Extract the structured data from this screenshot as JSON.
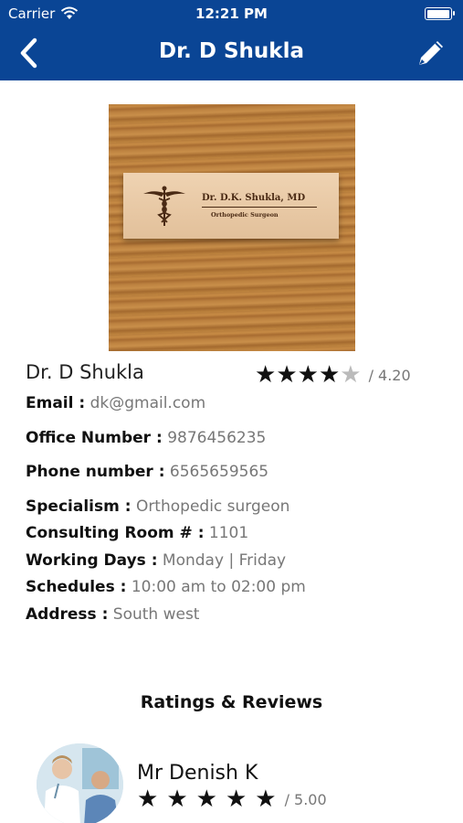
{
  "status_bar": {
    "carrier": "Carrier",
    "time": "12:21 PM"
  },
  "header": {
    "title": "Dr. D Shukla",
    "back_icon": "chevron-left-icon",
    "edit_icon": "pencil-icon"
  },
  "photo": {
    "plaque_name": "Dr. D.K. Shukla, MD",
    "plaque_subtitle": "Orthopedic Surgeon"
  },
  "doctor": {
    "name": "Dr. D Shukla",
    "rating": 4.2,
    "rating_text": "/ 4.20",
    "max_stars": 5,
    "filled_stars": 4
  },
  "details": {
    "email_label": "Email :",
    "email_value": "dk@gmail.com",
    "office_label": "Office Number :",
    "office_value": "9876456235",
    "phone_label": "Phone number :",
    "phone_value": "6565659565",
    "specialism_label": "Specialism :",
    "specialism_value": "Orthopedic surgeon",
    "room_label": "Consulting Room # :",
    "room_value": "1101",
    "days_label": "Working Days :",
    "days_value": "Monday | Friday",
    "schedule_label": "Schedules :",
    "schedule_value": "10:00 am to 02:00 pm",
    "address_label": "Address :",
    "address_value": "South west"
  },
  "reviews": {
    "title": "Ratings & Reviews",
    "items": [
      {
        "name": "Mr Denish K",
        "rating": 5.0,
        "rating_text": "/ 5.00"
      }
    ]
  },
  "colors": {
    "header_bg": "#0a4595",
    "label": "#111111",
    "value": "#777777"
  }
}
